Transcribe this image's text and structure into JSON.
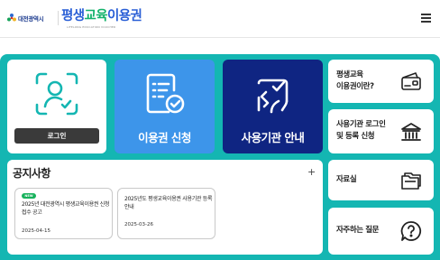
{
  "header": {
    "city_logo_text": "대전광역시",
    "brand_part1": "평생",
    "brand_part2": "교육",
    "brand_part3": "이용권",
    "brand_sub": "LIFELONG EDUCATION VOUCHER",
    "menu_icon": "hamburger-menu-icon"
  },
  "main": {
    "login": {
      "button_label": "로그인",
      "icon": "face-scan-icon"
    },
    "apply": {
      "label": "이용권 신청",
      "icon": "document-check-icon"
    },
    "guide": {
      "label": "사용기관 안내",
      "icon": "map-check-icon"
    }
  },
  "side": [
    {
      "label_line1": "평생교육",
      "label_line2": "이용권이란?",
      "icon": "card-wallet-icon"
    },
    {
      "label_line1": "사용기관 로그인",
      "label_line2": "및 등록 신청",
      "icon": "institution-building-icon"
    },
    {
      "label_line1": "자료실",
      "label_line2": "",
      "icon": "folder-files-icon"
    },
    {
      "label_line1": "자주하는 질문",
      "label_line2": "",
      "icon": "question-chat-icon"
    }
  ],
  "notice": {
    "title": "공지사항",
    "more": "+",
    "items": [
      {
        "badge": "NEW",
        "title": "2025년 대전광역시 평생교육이용권 신청 접수 공고",
        "date": "2025-04-15"
      },
      {
        "badge": "",
        "title": "2025년도 평생교육이용권 사용기관 등록 안내",
        "date": "2025-03-26"
      }
    ]
  },
  "colors": {
    "teal_background": "#14b6b2",
    "apply_blue": "#3d95ea",
    "guide_navy": "#0f2582",
    "login_button": "#3a3a3a",
    "new_badge": "#17b25c"
  }
}
